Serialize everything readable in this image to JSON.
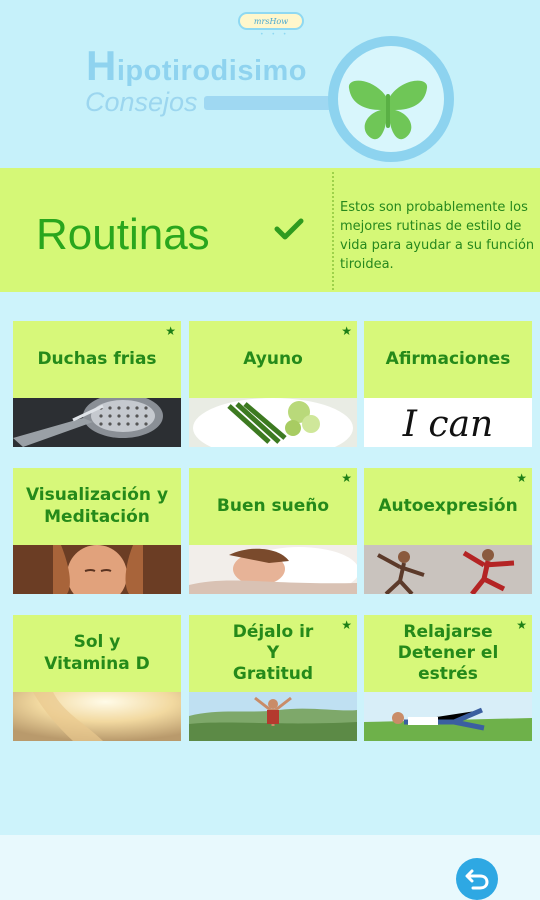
{
  "header": {
    "brand": "mrsHow",
    "brand_dots": "• • •",
    "title_initial": "H",
    "title_rest": "ipotirodisimo",
    "subtitle": "Consejos"
  },
  "banner": {
    "title": "Routinas",
    "description": "Estos son probablemente los mejores rutinas de estilo de vida para ayudar a su función tiroidea."
  },
  "cards": [
    {
      "label": "Duchas frias",
      "starred": true,
      "image": "shower-head-photo"
    },
    {
      "label": "Ayuno",
      "starred": true,
      "image": "vegetables-plate-photo"
    },
    {
      "label": "Afirmaciones",
      "starred": false,
      "image": "i-can-text-photo",
      "image_text": "I can"
    },
    {
      "label": "Visualización y\nMeditación",
      "starred": false,
      "image": "meditating-woman-photo"
    },
    {
      "label": "Buen sueño",
      "starred": true,
      "image": "sleeping-woman-photo"
    },
    {
      "label": "Autoexpresión",
      "starred": true,
      "image": "dancers-photo"
    },
    {
      "label": "Sol y\nVitamina D",
      "starred": false,
      "image": "sunlight-photo"
    },
    {
      "label": "Déjalo ir\nY\nGratitud",
      "starred": true,
      "image": "arms-raised-hiker-photo"
    },
    {
      "label": "Relajarse\nDetener el\nestrés",
      "starred": true,
      "image": "relaxing-on-grass-photo"
    }
  ],
  "star_glyph": "★",
  "colors": {
    "background": "#cdf3fb",
    "card_green": "#d7f87a",
    "text_green": "#258a1a",
    "back_button": "#2ea8e3"
  }
}
